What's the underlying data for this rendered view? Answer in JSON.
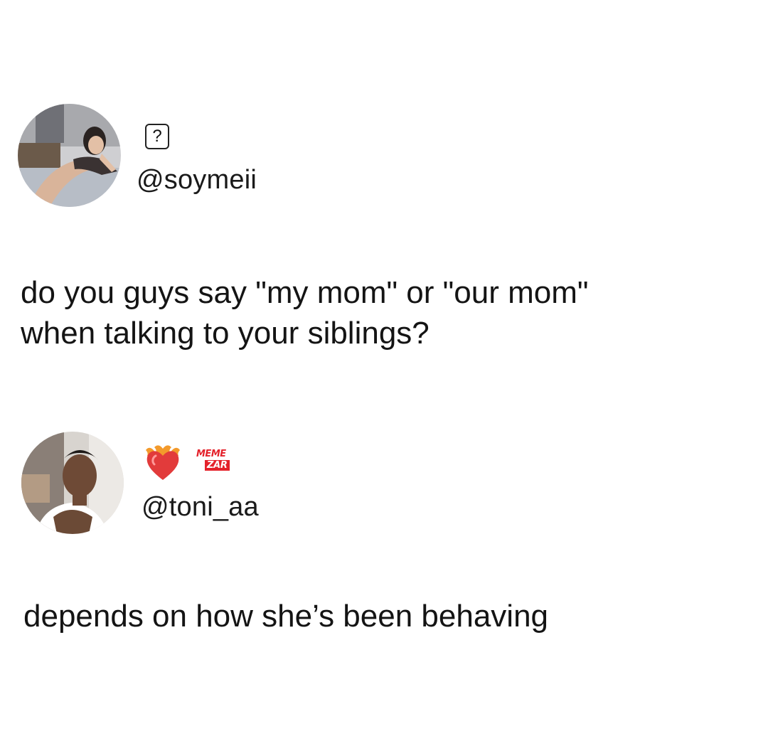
{
  "tweet1": {
    "display_name_glyph": "?",
    "handle": "@soymeii",
    "text": "do you guys say \"my mom\" or \"our mom\"\nwhen talking to your siblings?"
  },
  "tweet2": {
    "display_name_icon": "heart-on-fire-icon",
    "handle": "@toni_aa",
    "text": "depends on how she’s been behaving"
  },
  "watermark": {
    "line1": "MEME",
    "line2": "ZAR",
    "color": "#e4222b"
  }
}
